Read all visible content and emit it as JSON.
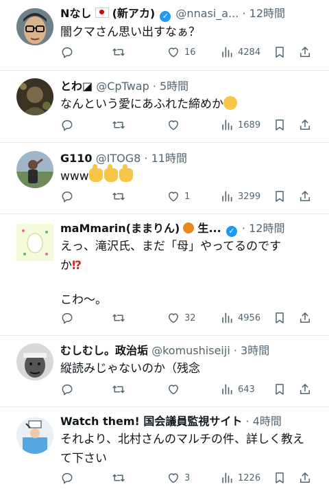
{
  "tweets": [
    {
      "name": "Nなし",
      "name_suffix": "(新アカ)",
      "handle": "@nnasi_a...",
      "dot": "·",
      "time": "12時間",
      "text": "闇クマさん思い出すなぁ？",
      "likes": "16",
      "views": "4284",
      "avatar": "cartoon-glasses-face"
    },
    {
      "name": "とわ◪",
      "handle": "@CpTwap",
      "dot": "·",
      "time": "5時間",
      "text": "なんという愛にあふれた締めか",
      "likes": "",
      "views": "1689",
      "avatar": "dark-photo-portrait"
    },
    {
      "name": "G110",
      "handle": "@ITOG8",
      "dot": "·",
      "time": "11時間",
      "text": "www",
      "likes": "1",
      "views": "3299",
      "avatar": "person-outdoors"
    },
    {
      "name": "maMmarin(ままりん)",
      "name_suffix": "生...",
      "handle": "",
      "dot": "·",
      "time": "12時間",
      "text": "えっ、滝沢氏、まだ「母」やってるのです\nか",
      "text2": "こわ〜。",
      "likes": "32",
      "views": "4956",
      "avatar": "egg-illustration"
    },
    {
      "name": "むしむし。政治垢",
      "handle": "@komushiseiji",
      "dot": "·",
      "time": "3時間",
      "text": "縦読みじゃないのか（残念",
      "likes": "",
      "views": "643",
      "avatar": "headband-man-bw"
    },
    {
      "name": "Watch them! 国会議員監視サイト",
      "handle": "",
      "dot": "·",
      "time": "4時間",
      "text": "それより、北村さんのマルチの件、詳しく教え\nて下さい",
      "likes": "3",
      "views": "1226",
      "avatar": "blue-illustration-sign"
    }
  ],
  "colors": {
    "secondary": "#536471",
    "verified": "#1d9bf0",
    "divider": "#e6e9ec"
  },
  "icons": [
    "reply-icon",
    "retweet-icon",
    "like-icon",
    "views-icon",
    "bookmark-icon",
    "share-icon"
  ]
}
